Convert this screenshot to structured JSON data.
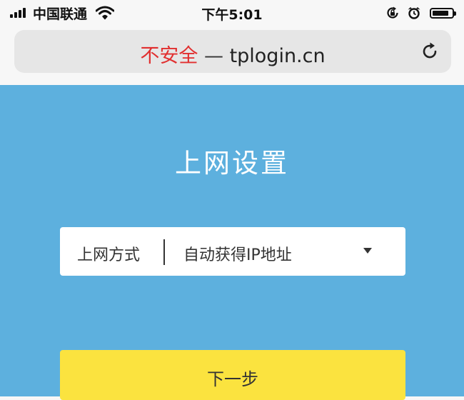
{
  "status_bar": {
    "carrier": "中国联通",
    "time": "下午5:01",
    "battery_level": 0.85
  },
  "address_bar": {
    "insecure_label": "不安全",
    "separator": "—",
    "host": "tplogin.cn"
  },
  "main": {
    "title": "上网设置",
    "connection_select": {
      "label": "上网方式",
      "value": "自动获得IP地址"
    },
    "next_button_label": "下一步"
  },
  "colors": {
    "background": "#5db0de",
    "insecure": "#e12f2f",
    "button": "#fbe33f"
  },
  "icons": [
    "signal-icon",
    "wifi-icon",
    "orientation-lock-icon",
    "alarm-icon",
    "battery-icon",
    "reload-icon",
    "chevron-down-icon"
  ]
}
